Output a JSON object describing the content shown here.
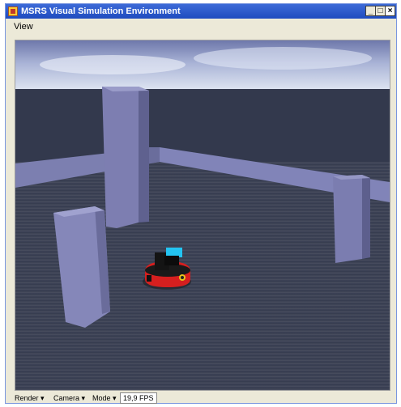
{
  "window": {
    "title": "MSRS Visual Simulation Environment"
  },
  "titlebar_buttons": {
    "minimize": "_",
    "maximize": "□",
    "close": "×"
  },
  "menu": {
    "view": "View"
  },
  "statusbar": {
    "render_label": "Render",
    "camera_label": "Camera",
    "mode_label": "Mode",
    "dropdown_glyph": "▾",
    "fps": "19,9 FPS"
  },
  "colors": {
    "sky_top": "#6a74a8",
    "sky_horizon": "#c8d2e8",
    "floor": "#3b4052",
    "wall": "#7a7db0",
    "robot_body": "#d81e1e",
    "robot_sensor": "#22c7f0"
  }
}
